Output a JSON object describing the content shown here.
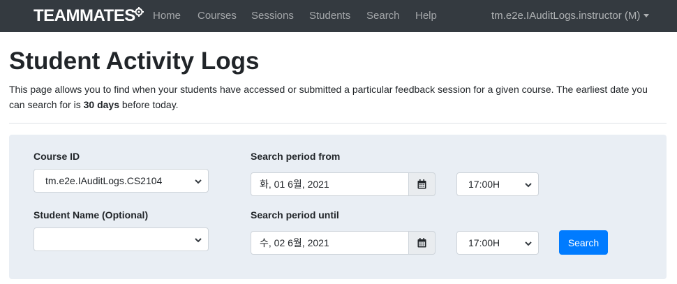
{
  "navbar": {
    "brand": "TEAMMATES",
    "links": [
      "Home",
      "Courses",
      "Sessions",
      "Students",
      "Search",
      "Help"
    ],
    "user": "tm.e2e.IAuditLogs.instructor (M)"
  },
  "header": {
    "title": "Student Activity Logs",
    "intro_before": "This page allows you to find when your students have accessed or submitted a particular feedback session for a given course. The earliest date you can search for is ",
    "intro_bold": "30 days",
    "intro_after": " before today."
  },
  "form": {
    "course_label": "Course ID",
    "course_value": "tm.e2e.IAuditLogs.CS2104",
    "student_label": "Student Name (Optional)",
    "student_value": "",
    "from_label": "Search period from",
    "from_date": "화, 01 6월, 2021",
    "from_time": "17:00H",
    "until_label": "Search period until",
    "until_date": "수, 02 6월, 2021",
    "until_time": "17:00H",
    "search_label": "Search"
  },
  "icons": {
    "calendar": "calendar-icon",
    "chevron": "chevron-down-icon",
    "caret": "caret-down-icon",
    "gear": "gear-icon"
  },
  "colors": {
    "navbar": "#343a40",
    "panel": "#e9eef4",
    "primary": "#007bff"
  }
}
